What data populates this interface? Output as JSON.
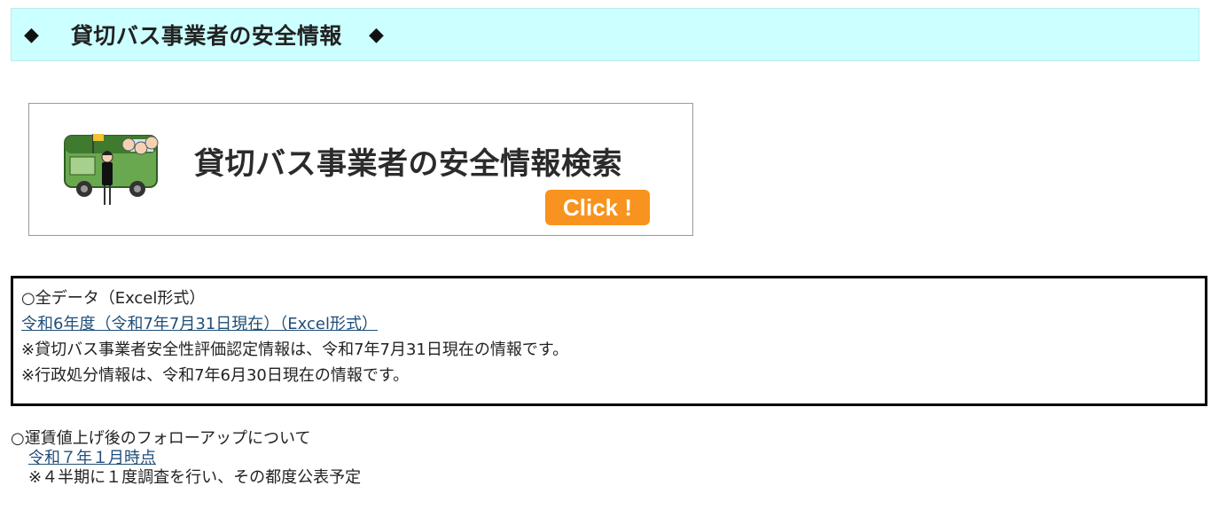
{
  "header": {
    "diamond_left": "◆",
    "title": "貸切バス事業者の安全情報",
    "diamond_right": "◆"
  },
  "banner": {
    "title": "貸切バス事業者の安全情報検索",
    "click_label": "Click !"
  },
  "data_section": {
    "heading": "○全データ（Excel形式）",
    "link_label": "令和6年度（令和7年7月31日現在）（Excel形式）",
    "note1": "※貸切バス事業者安全性評価認定情報は、令和7年7月31日現在の情報です。",
    "note2": "※行政処分情報は、令和7年6月30日現在の情報です。"
  },
  "followup": {
    "heading": "○運賃値上げ後のフォローアップについて",
    "link_label": "令和７年１月時点",
    "note": "※４半期に１度調査を行い、その都度公表予定"
  }
}
